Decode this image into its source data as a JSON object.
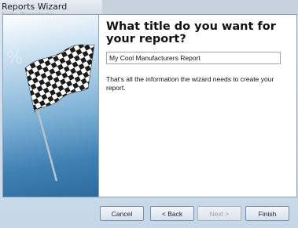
{
  "background_window": {
    "title": "Reports Wizard",
    "ghost_text": "Suite Projectnew"
  },
  "wizard": {
    "heading": "What title do you want for your report?",
    "title_field": {
      "value": "My Cool Manufacturers Report",
      "placeholder": ""
    },
    "info_text": "That's all the information the wizard needs to create your report.",
    "image": {
      "icon": "checkered-flag-icon",
      "accent": "#3f80b3"
    }
  },
  "buttons": {
    "cancel": "Cancel",
    "back": "< Back",
    "next": "Next >",
    "finish": "Finish"
  }
}
